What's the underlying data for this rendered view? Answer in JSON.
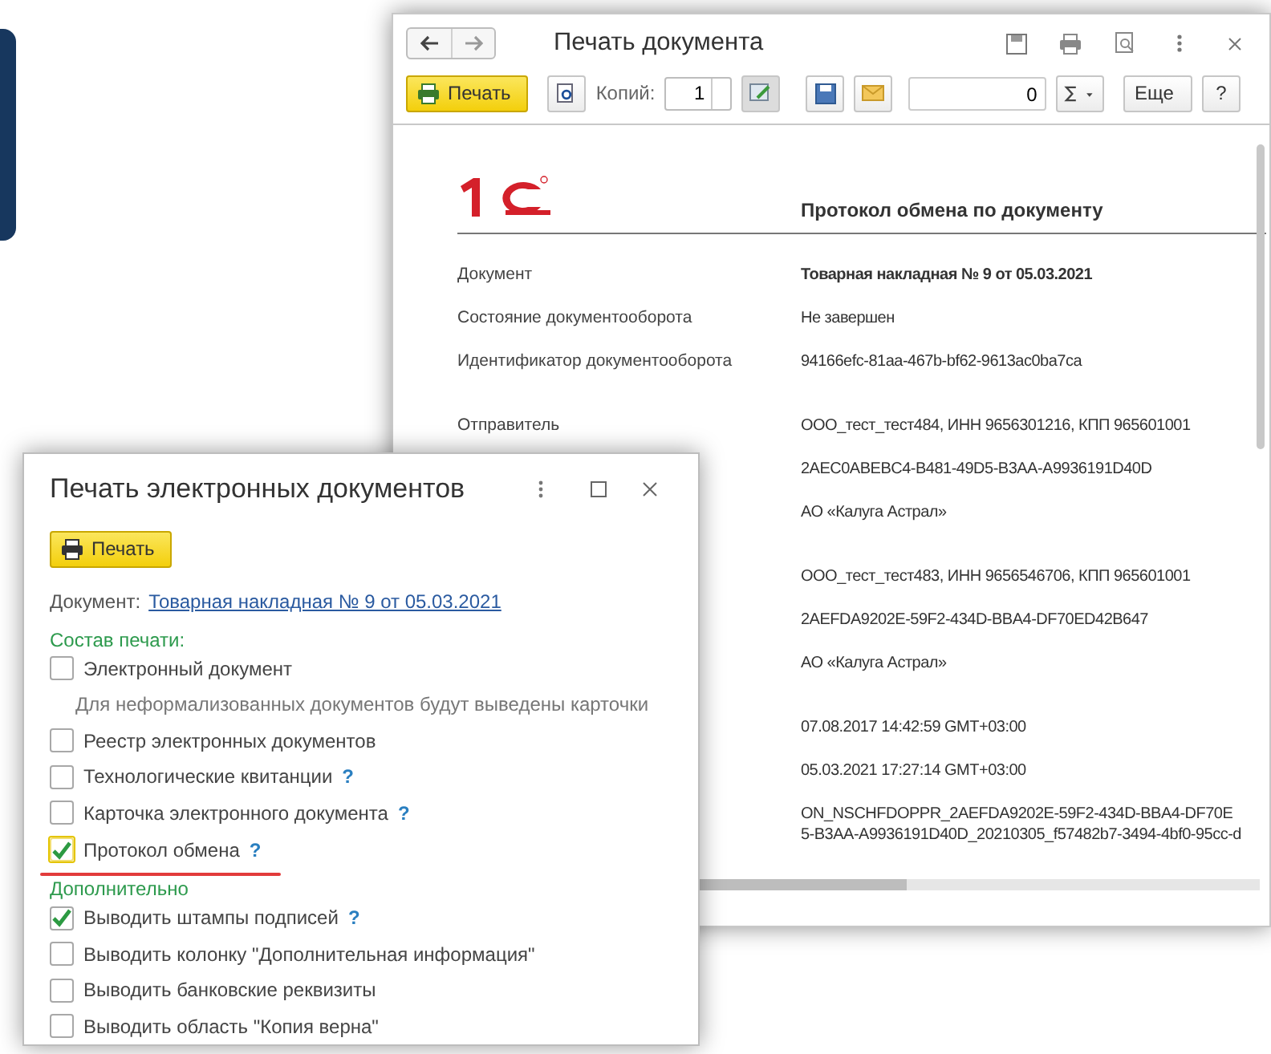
{
  "back_window": {
    "title": "Печать документа",
    "toolbar": {
      "print_button": "Печать",
      "copies_label": "Копий:",
      "copies_value": "1",
      "amount_value": "0",
      "more_button": "Еще",
      "help_button": "?"
    },
    "document": {
      "heading": "Протокол обмена по документу",
      "blocks": [
        {
          "rows": [
            {
              "label": "Документ",
              "values": [
                "Товарная накладная № 9 от 05.03.2021"
              ],
              "bold": true
            },
            {
              "label": "Состояние документооборота",
              "values": [
                "Не завершен"
              ],
              "bold": false
            },
            {
              "label": "Идентификатор документооборота",
              "values": [
                "94166efc-81aa-467b-bf62-9613ac0ba7ca"
              ],
              "bold": false
            }
          ]
        },
        {
          "rows": [
            {
              "label": "Отправитель",
              "values": [
                "ООО_тест_тест484, ИНН 9656301216, КПП 965601001"
              ],
              "bold": false
            },
            {
              "values": [
                "2AEC0ABEBC4-B481-49D5-B3AA-A9936191D40D"
              ],
              "bold": false
            },
            {
              "values": [
                "АО «Калуга Астрал»"
              ],
              "bold": false
            }
          ]
        },
        {
          "rows": [
            {
              "values": [
                "ООО_тест_тест483, ИНН 9656546706, КПП 965601001"
              ],
              "bold": false
            },
            {
              "values": [
                "2AEFDA9202E-59F2-434D-BBA4-DF70ED42B647"
              ],
              "bold": false
            },
            {
              "values": [
                "АО «Калуга Астрал»"
              ],
              "bold": false
            }
          ]
        },
        {
          "rows": [
            {
              "values": [
                "07.08.2017 14:42:59 GMT+03:00"
              ],
              "bold": false
            },
            {
              "values": [
                "05.03.2021 17:27:14 GMT+03:00"
              ],
              "bold": false
            },
            {
              "values": [
                "ON_NSCHFDOPPR_2AEFDA9202E-59F2-434D-BBA4-DF70E",
                "5-B3AA-A9936191D40D_20210305_f57482b7-3494-4bf0-95cc-d"
              ],
              "bold": false
            }
          ]
        }
      ]
    }
  },
  "front_window": {
    "title": "Печать электронных документов",
    "print_button": "Печать",
    "document_label": "Документ:",
    "document_link": "Товарная накладная № 9 от 05.03.2021",
    "sections": [
      {
        "title": "Состав печати:",
        "items": [
          {
            "kind": "checkbox",
            "label": "Электронный документ",
            "checked": false,
            "focused": false
          },
          {
            "kind": "note",
            "label": "Для неформализованных документов будут выведены карточки"
          },
          {
            "kind": "checkbox",
            "label": "Реестр электронных документов",
            "checked": false,
            "focused": false
          },
          {
            "kind": "checkbox",
            "label": "Технологические квитанции",
            "help": "?",
            "checked": false,
            "focused": false
          },
          {
            "kind": "checkbox",
            "label": "Карточка электронного документа",
            "help": "?",
            "checked": false,
            "focused": false
          },
          {
            "kind": "checkbox",
            "label": "Протокол обмена",
            "help": "?",
            "checked": true,
            "focused": true
          }
        ]
      },
      {
        "title": "Дополнительно",
        "items": [
          {
            "kind": "checkbox",
            "label": "Выводить штампы подписей",
            "help": "?",
            "checked": true,
            "focused": false
          },
          {
            "kind": "checkbox",
            "label": "Выводить колонку \"Дополнительная информация\"",
            "checked": false,
            "focused": false
          },
          {
            "kind": "checkbox",
            "label": "Выводить банковские реквизиты",
            "checked": false,
            "focused": false
          },
          {
            "kind": "checkbox",
            "label": "Выводить область \"Копия верна\"",
            "checked": false,
            "focused": false
          }
        ]
      }
    ]
  }
}
